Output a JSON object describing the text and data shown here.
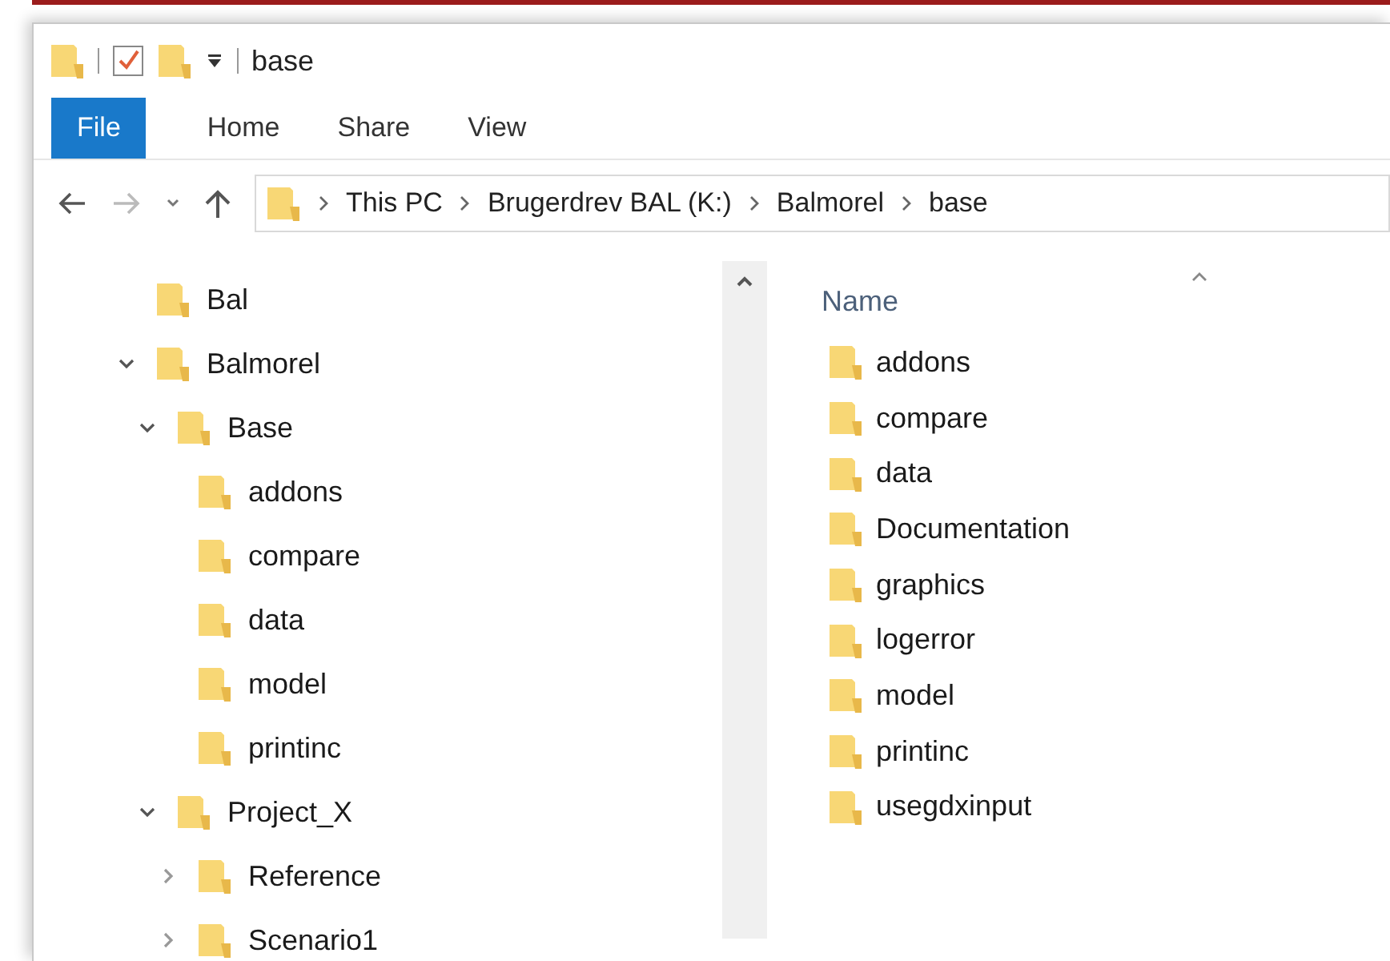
{
  "window": {
    "title": "base"
  },
  "ribbon_tabs": [
    {
      "label": "File",
      "selected": true
    },
    {
      "label": "Home",
      "selected": false
    },
    {
      "label": "Share",
      "selected": false
    },
    {
      "label": "View",
      "selected": false
    }
  ],
  "address_bar": {
    "path": [
      "This PC",
      "Brugerdrev BAL (K:)",
      "Balmorel",
      "base"
    ]
  },
  "navigation_tree": [
    {
      "label": "Bal",
      "kind": "leaf"
    },
    {
      "label": "Balmorel",
      "kind": "expandable",
      "expanded": true,
      "children": [
        {
          "label": "Base",
          "kind": "expandable",
          "expanded": true,
          "children": [
            {
              "label": "addons",
              "kind": "leaf"
            },
            {
              "label": "compare",
              "kind": "leaf"
            },
            {
              "label": "data",
              "kind": "leaf"
            },
            {
              "label": "model",
              "kind": "leaf"
            },
            {
              "label": "printinc",
              "kind": "leaf"
            }
          ]
        },
        {
          "label": "Project_X",
          "kind": "expandable",
          "expanded": true,
          "children": [
            {
              "label": "Reference",
              "kind": "expandable",
              "expanded": false
            },
            {
              "label": "Scenario1",
              "kind": "expandable",
              "expanded": false
            }
          ]
        }
      ]
    }
  ],
  "file_list": {
    "column": "Name",
    "items": [
      "addons",
      "compare",
      "data",
      "Documentation",
      "graphics",
      "logerror",
      "model",
      "printinc",
      "usegdxinput"
    ]
  }
}
